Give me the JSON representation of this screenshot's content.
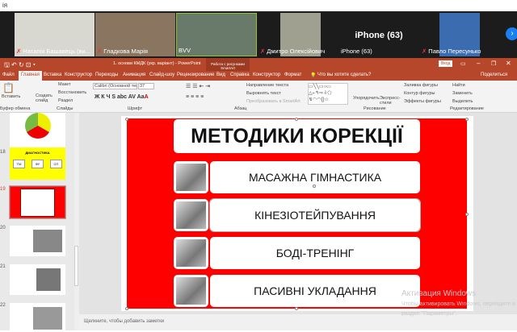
{
  "window": {
    "title_fragment": "ія"
  },
  "participants": [
    {
      "name": "Наталія Башавець (ви...",
      "muted": true
    },
    {
      "name": "Гладкова Марія",
      "muted": true
    },
    {
      "name": "BVV",
      "muted": false
    },
    {
      "name": "Дмитро Олексійович",
      "muted": true
    },
    {
      "name": "iPhone (63)",
      "muted": false,
      "big_label": "iPhone (63)"
    },
    {
      "name": "Павло Пересунько",
      "muted": true
    }
  ],
  "ppt": {
    "doc_title": "1. основи КМДК (укр. варіант) - PowerPoint",
    "context_tab": "Работа с рисунками SmartArt",
    "login": "Вход",
    "share": "Поделиться",
    "tellme": "Что вы хотите сделать?",
    "tabs": [
      "Файл",
      "Главная",
      "Вставка",
      "Конструктор",
      "Переходы",
      "Анимация",
      "Слайд-шоу",
      "Рецензирование",
      "Вид",
      "Справка",
      "Конструктор",
      "Формат"
    ]
  },
  "ribbon": {
    "paste": "Вставить",
    "clipboard": "Буфер обмена",
    "new_slide": "Создать слайд",
    "layout": "Макет",
    "reset": "Восстановить",
    "section": "Раздел",
    "slides": "Слайды",
    "font_name": "Calibri (Основной тек",
    "font_size": "37",
    "font": "Шрифт",
    "text_dir": "Направление текста",
    "align_text": "Выровнять текст",
    "smartart": "Преобразовать в SmartArt",
    "paragraph": "Абзац",
    "arrange": "Упорядочить",
    "quick_styles": "Экспресс-стили",
    "fill": "Заливка фигуры",
    "outline": "Контур фигуры",
    "effects": "Эффекты фигуры",
    "drawing": "Рисование",
    "find": "Найти",
    "replace": "Заменить",
    "select": "Выделить",
    "editing": "Редактирование"
  },
  "thumbs": [
    {
      "num": ""
    },
    {
      "num": "18",
      "title": "ДИАГНОСТИКА",
      "items": [
        "ТМ",
        "ФУ",
        "СП"
      ]
    },
    {
      "num": "19"
    },
    {
      "num": "20"
    },
    {
      "num": "21"
    },
    {
      "num": "22"
    }
  ],
  "slide": {
    "title": "МЕТОДИКИ КОРЕКЦІЇ",
    "items": [
      "МАСАЖНА ГІМНАСТИКА",
      "КІНЕЗІОТЕЙПУВАННЯ",
      "БОДІ-ТРЕНІНГ",
      "ПАСИВНІ УКЛАДАННЯ"
    ]
  },
  "notes_placeholder": "Щелкните, чтобы добавить заметки",
  "watermark": {
    "line1": "Активация Windows",
    "line2": "Чтобы активировать Windows, перейдите в",
    "line3": "раздел \"Параметры\"."
  },
  "colors": {
    "accent": "#b7472a",
    "slide_red": "#ff0000"
  }
}
